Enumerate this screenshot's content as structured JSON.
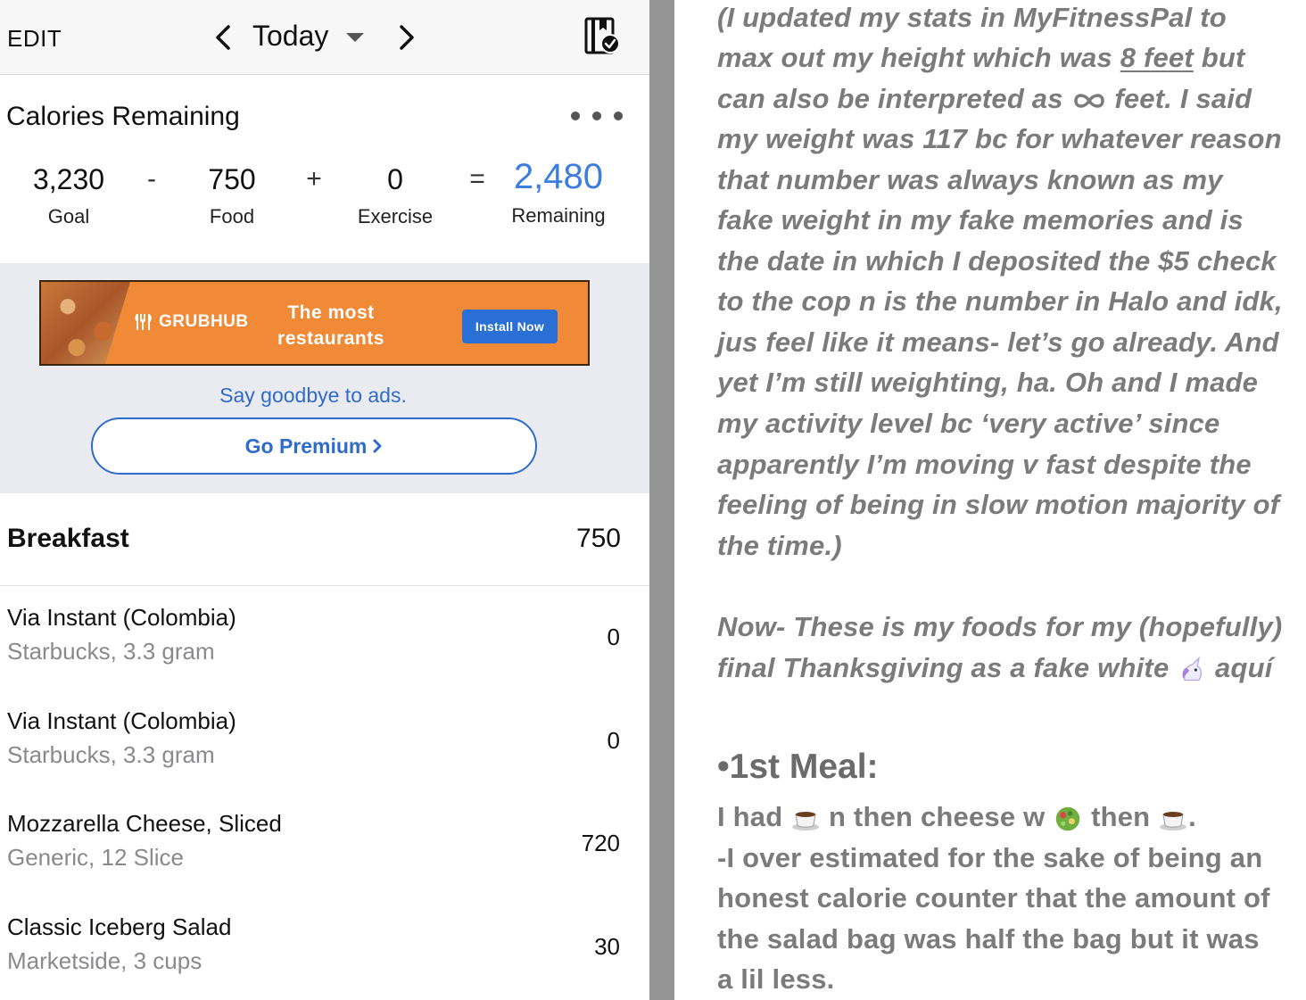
{
  "left": {
    "topbar": {
      "edit_label": "EDIT",
      "day_label": "Today"
    },
    "calories": {
      "title": "Calories Remaining",
      "goal": "3,230",
      "goal_label": "Goal",
      "op_minus": "-",
      "food": "750",
      "food_label": "Food",
      "op_plus": "+",
      "exercise": "0",
      "exercise_label": "Exercise",
      "op_equals": "=",
      "remaining": "2,480",
      "remaining_label": "Remaining",
      "remaining_color": "#3c7de0"
    },
    "ad": {
      "brand": "GRUBHUB",
      "line1": "The most",
      "line2": "restaurants",
      "install_label": "Install Now",
      "goodbye_text": "Say goodbye to ads.",
      "premium_label": "Go Premium"
    },
    "meal": {
      "name": "Breakfast",
      "calories": "750",
      "items": [
        {
          "name": "Via Instant (Colombia)",
          "detail": "Starbucks, 3.3 gram",
          "calories": "0"
        },
        {
          "name": "Via Instant (Colombia)",
          "detail": "Starbucks, 3.3 gram",
          "calories": "0"
        },
        {
          "name": "Mozzarella Cheese, Sliced",
          "detail": "Generic, 12 Slice",
          "calories": "720"
        },
        {
          "name": "Classic Iceberg Salad",
          "detail": "Marketside, 3 cups",
          "calories": "30"
        }
      ]
    }
  },
  "right": {
    "para1": {
      "l1": "(I updated my stats in MyFitnessPal to",
      "l2a": "max out my height which was ",
      "l2u": "8 feet",
      "l2b": " but",
      "l3a": "can also be interpreted as ",
      "l3b": " feet. I said",
      "l4": "my weight was 117 bc for whatever reason",
      "l5": "that number was always known as my",
      "l6": "fake weight in my fake memories and is",
      "l7": "the date in which I deposited the $5 check",
      "l8": "to the cop n is the number in Halo and idk,",
      "l9": "jus feel like it means- let’s go already. And",
      "l10": "yet I’m still weighting, ha. Oh and I made",
      "l11": "my activity level bc ‘very active’ since",
      "l12": "apparently I’m moving v fast despite the",
      "l13": "feeling of being in slow motion majority of",
      "l14": "the time.)"
    },
    "para2": {
      "l1": "Now- These is my foods for my (hopefully)",
      "l2a": "final Thanksgiving as a fake white ",
      "l2b": " aquí"
    },
    "meal1": {
      "heading": "•1st Meal:",
      "l1a": "I had ",
      "l1b": " n then cheese w ",
      "l1c": " then ",
      "l1d": ".",
      "l2": "-I over estimated for the sake of being an",
      "l3": "honest calorie counter that the amount of",
      "l4": "the salad bag was half the bag but it was",
      "l5": "a lil less."
    },
    "icons": [
      "infinity-icon",
      "unicorn-emoji",
      "coffee-emoji",
      "salad-emoji"
    ]
  }
}
